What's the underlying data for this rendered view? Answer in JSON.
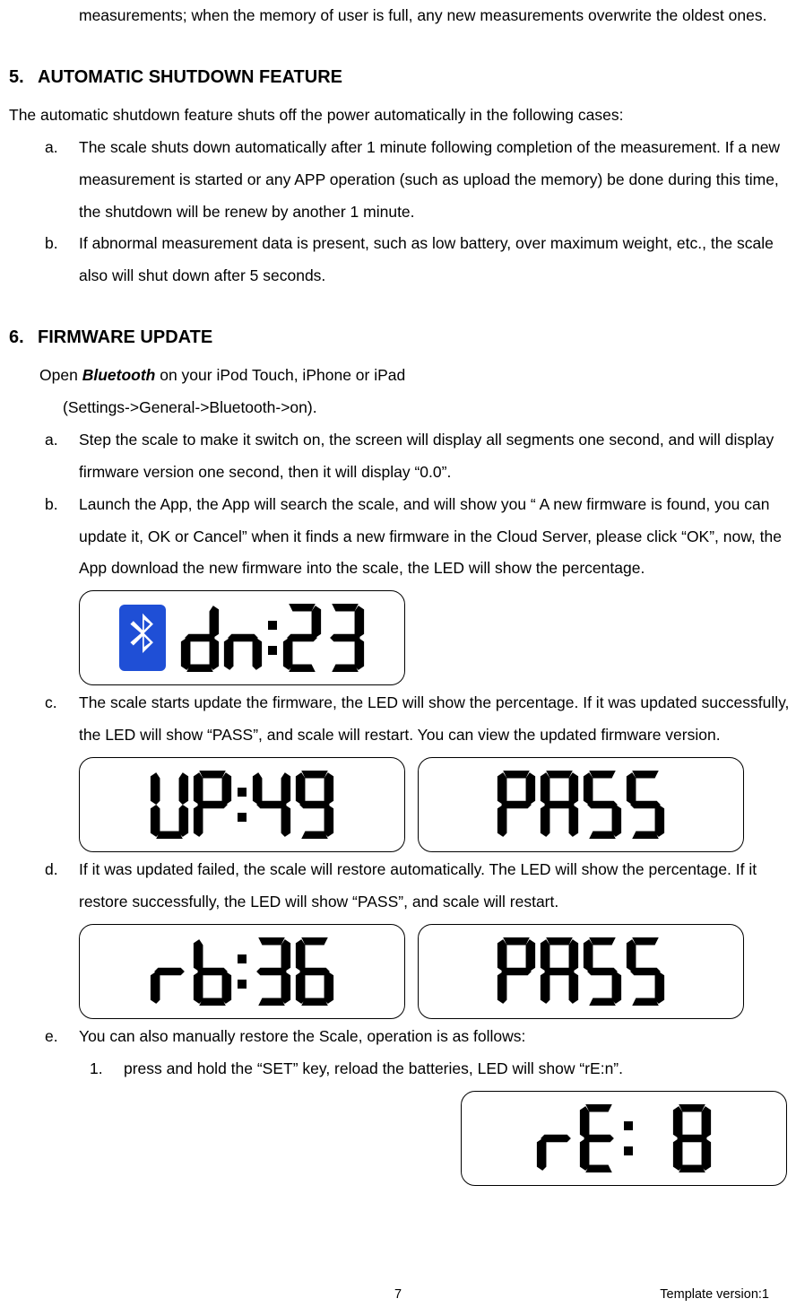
{
  "intro_fragment": "measurements; when the memory of user is full, any new measurements overwrite the oldest ones.",
  "section5": {
    "num": "5.",
    "title": "AUTOMATIC SHUTDOWN FEATURE",
    "lead": "The automatic shutdown feature shuts off the power automatically in the following cases:",
    "a": "The scale shuts down automatically after 1 minute following completion of the measurement. If a new measurement is started or any APP operation (such as upload the memory) be done during this time, the shutdown will be renew by another 1 minute.",
    "b": "If abnormal measurement data is present, such as low battery, over maximum weight, etc., the scale also will shut down after 5 seconds."
  },
  "section6": {
    "num": "6.",
    "title": "FIRMWARE UPDATE",
    "open_pre": "Open ",
    "open_bold": "Bluetooth",
    "open_post": " on your iPod Touch, iPhone or iPad",
    "open_sub": "(Settings->General->Bluetooth->on).",
    "a": "Step the scale to make it switch on, the screen will display all segments one second, and will display firmware version one second, then it will display “0.0”.",
    "b": "Launch the App, the App will search the scale, and will show you “ A new firmware is found, you can update it, OK or Cancel” when it finds a new firmware in the Cloud Server, please click “OK”, now, the App download the new firmware into the scale, the LED will show the percentage.",
    "c": "The scale starts update the firmware, the LED will show the percentage. If it was updated successfully, the LED will show “PASS”, and scale will restart. You can view the updated firmware version.",
    "d": "If it was updated failed, the scale will restore automatically. The LED will show the percentage. If it restore successfully, the LED will show “PASS”, and scale will restart.",
    "e": "You can also manually restore the Scale, operation is as follows:",
    "e1": "press and hold the “SET” key, reload the batteries, LED will show “rE:n”."
  },
  "lcd": {
    "b": {
      "icon": "bluetooth-icon",
      "text": "dn:23"
    },
    "c1": {
      "text": "UP:49"
    },
    "c2": {
      "text": "PASS"
    },
    "d1": {
      "text": "rb:36"
    },
    "d2": {
      "text": "PASS"
    },
    "e1": {
      "text": "rE: 8"
    }
  },
  "footer": {
    "page": "7",
    "template": "Template version:1"
  }
}
